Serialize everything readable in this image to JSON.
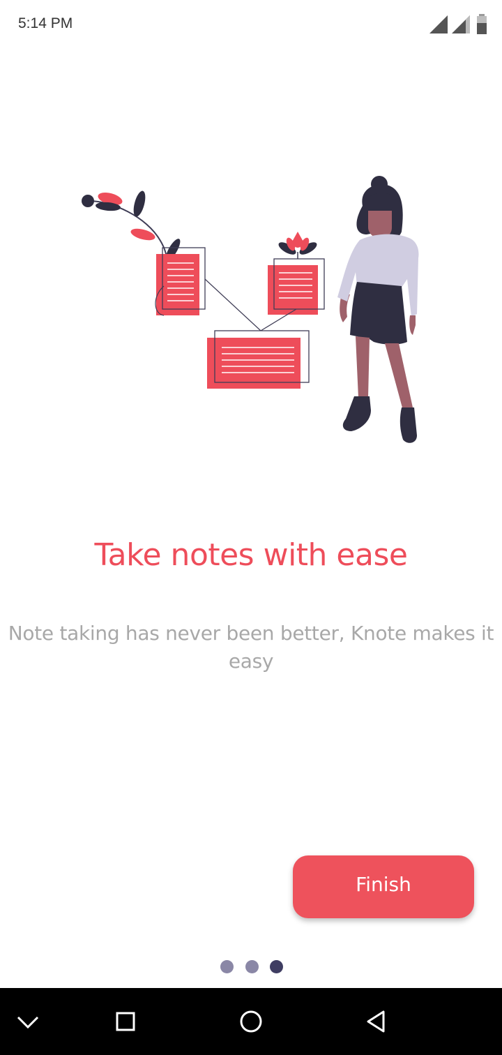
{
  "status_bar": {
    "time": "5:14 PM"
  },
  "onboarding": {
    "title": "Take notes with ease",
    "subtitle": "Note taking has never been better, Knote makes it easy",
    "finish_label": "Finish",
    "current_page": 3,
    "total_pages": 3
  },
  "colors": {
    "accent": "#ee525c",
    "title": "#ee4d5a",
    "subtitle": "#a8a8a8",
    "dot_inactive": "#8a87a6",
    "dot_active": "#3f3d62",
    "figure_dark": "#2f2e41",
    "figure_shirt": "#d0cde1"
  },
  "icons": {
    "signal_1": "signal-icon",
    "signal_2": "signal-icon",
    "battery": "battery-icon",
    "nav_down": "chevron-down-icon",
    "nav_recents": "square-icon",
    "nav_home": "circle-icon",
    "nav_back": "triangle-back-icon"
  }
}
